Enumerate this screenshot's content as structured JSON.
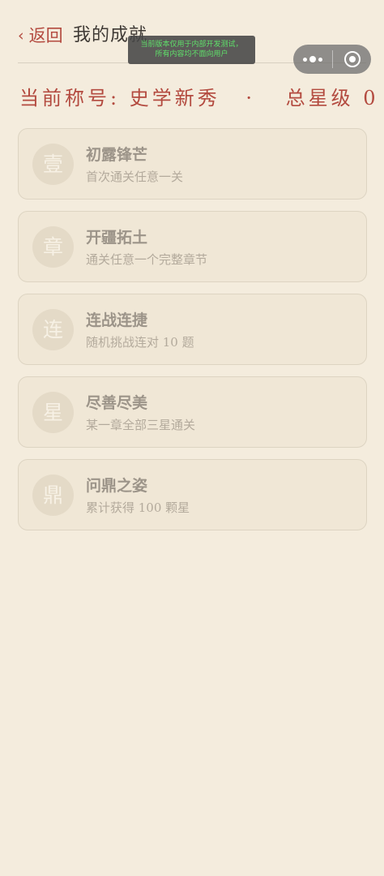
{
  "header": {
    "back_label": "返回",
    "back_chevron": "‹",
    "title": "我的成就"
  },
  "dev_notice": {
    "line1": "当前版本仅用于内部开发测试，",
    "line2": "所有内容均不面向用户",
    "color": "#5fe06a"
  },
  "capsule": {
    "more_icon": "more-dots-icon",
    "close_icon": "target-close-icon"
  },
  "rank": {
    "title_label": "当前称号:",
    "title_value": "史学新秀",
    "separator": "·",
    "stars_label": "总星级",
    "stars_value": "0"
  },
  "achievements": [
    {
      "badge": "壹",
      "title": "初露锋芒",
      "desc": "首次通关任意一关"
    },
    {
      "badge": "章",
      "title": "开疆拓土",
      "desc": "通关任意一个完整章节"
    },
    {
      "badge": "连",
      "title": "连战连捷",
      "desc": "随机挑战连对 10 题"
    },
    {
      "badge": "星",
      "title": "尽善尽美",
      "desc": "某一章全部三星通关"
    },
    {
      "badge": "鼎",
      "title": "问鼎之姿",
      "desc": "累计获得 100 颗星"
    }
  ],
  "colors": {
    "background": "#f4ecdd",
    "accent": "#b34a3f",
    "card": "#f0e7d6",
    "locked_text": "#9c9489"
  }
}
